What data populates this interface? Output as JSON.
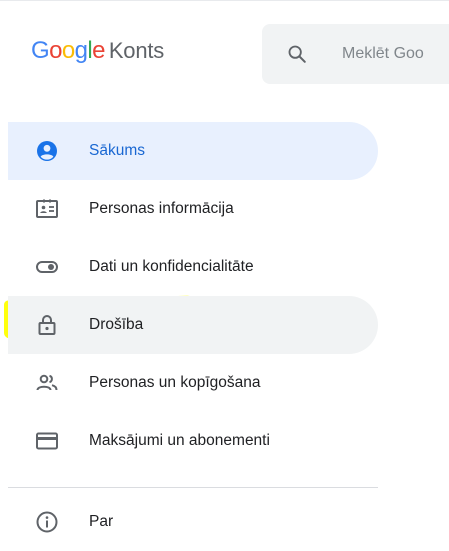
{
  "header": {
    "logo": {
      "letters": [
        {
          "ch": "G",
          "color": "#4285F4"
        },
        {
          "ch": "o",
          "color": "#EA4335"
        },
        {
          "ch": "o",
          "color": "#FBBC05"
        },
        {
          "ch": "g",
          "color": "#4285F4"
        },
        {
          "ch": "l",
          "color": "#34A853"
        },
        {
          "ch": "e",
          "color": "#EA4335"
        }
      ],
      "product": "Konts"
    },
    "search": {
      "placeholder": "Meklēt Goo",
      "icon": "search-icon"
    }
  },
  "nav": {
    "items": [
      {
        "label": "Sākums",
        "icon": "account-circle-icon",
        "state": "active"
      },
      {
        "label": "Personas informācija",
        "icon": "id-card-icon",
        "state": ""
      },
      {
        "label": "Dati un konfidencialitāte",
        "icon": "toggle-icon",
        "state": ""
      },
      {
        "label": "Drošība",
        "icon": "lock-icon",
        "state": "hover"
      },
      {
        "label": "Personas un kopīgošana",
        "icon": "people-icon",
        "state": ""
      },
      {
        "label": "Maksājumi un abonementi",
        "icon": "credit-card-icon",
        "state": ""
      }
    ],
    "about": {
      "label": "Par",
      "icon": "info-icon"
    }
  },
  "colors": {
    "active_bg": "#e8f0fe",
    "active_text": "#1967d2",
    "hover_bg": "#f1f3f4",
    "highlight": "#ffff00",
    "icon": "#5f6368"
  }
}
